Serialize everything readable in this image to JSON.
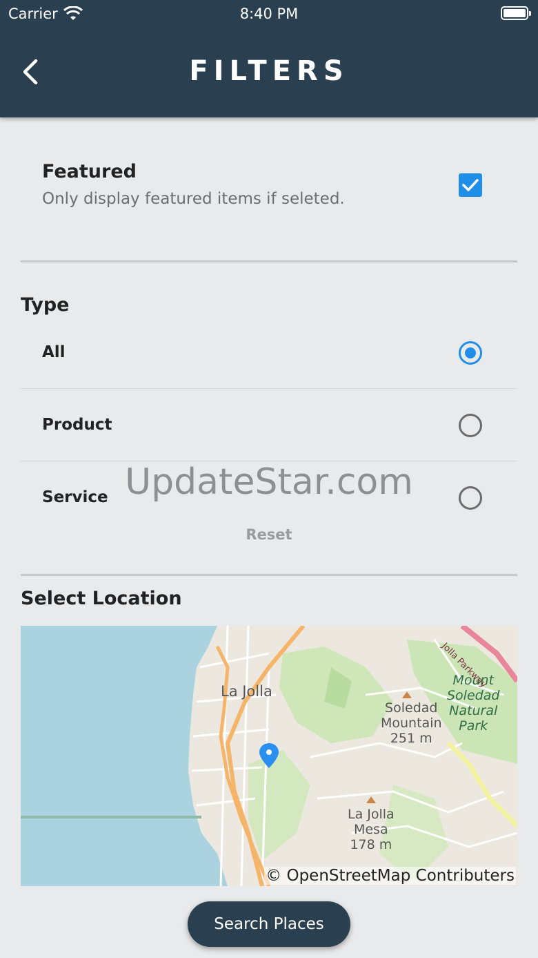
{
  "status_bar": {
    "carrier": "Carrier",
    "time": "8:40 PM"
  },
  "header": {
    "title": "FILTERS"
  },
  "featured": {
    "title": "Featured",
    "description": "Only display featured items if seleted.",
    "checked": true
  },
  "type": {
    "title": "Type",
    "options": [
      {
        "label": "All",
        "selected": true
      },
      {
        "label": "Product",
        "selected": false
      },
      {
        "label": "Service",
        "selected": false
      }
    ],
    "reset_label": "Reset"
  },
  "watermark": "UpdateStar.com",
  "location": {
    "title": "Select Location",
    "attribution": "© OpenStreetMap Contributers",
    "map_labels": {
      "la_jolla": "La Jolla",
      "soledad_mountain": "Soledad\nMountain\n251 m",
      "mount_soledad_park": "Mount\nSoledad\nNatural\nPark",
      "la_jolla_mesa": "La Jolla\nMesa\n178 m",
      "parkway": "Jolla Parkway"
    }
  },
  "search_button": "Search Places",
  "colors": {
    "header": "#2a3f4f",
    "accent": "#1e8ee9",
    "background": "#e9eaeb"
  }
}
